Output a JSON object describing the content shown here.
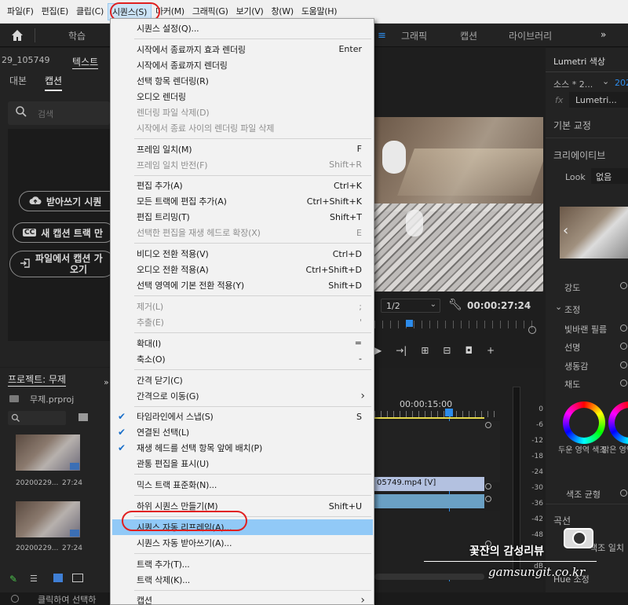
{
  "menubar": {
    "items": [
      "파일(F)",
      "편집(E)",
      "클립(C)",
      "시퀀스(S)",
      "마커(M)",
      "그래픽(G)",
      "보기(V)",
      "창(W)",
      "도움말(H)"
    ]
  },
  "workspace": {
    "tab_learn": "학습",
    "tab_graphics": "그래픽",
    "tab_captions": "캡션",
    "tab_libraries": "라이브러리",
    "more": "»"
  },
  "text_panel": {
    "sequence_name": "29_105749",
    "panel_title": "텍스트",
    "tab_transcript": "대본",
    "tab_captions": "캡션",
    "search_placeholder": "검색",
    "btn_transcribe": "받아쓰기 시퀀",
    "btn_new_caption_track": "새 캡션 트랙 만",
    "btn_import_captions_line1": "파일에서 캡션 가",
    "btn_import_captions_line2": "오기"
  },
  "program_monitor": {
    "resolution": "1/2",
    "timecode": "00:00:27:24"
  },
  "lumetri": {
    "title": "Lumetri 색상",
    "source_label": "소스 * 2...",
    "source_right": "202",
    "fx_label": "fx",
    "effect_name": "Lumetri...",
    "basic_correction": "기본 교정",
    "creative": "크리에이티브",
    "look_label": "Look",
    "look_value": "없음",
    "intensity": "강도",
    "adjust": "조정",
    "faded_film": "빛바랜 필름",
    "sharpen": "선명",
    "vibrance": "생동감",
    "saturation": "채도",
    "shadow_tint": "두운 영역 색조",
    "highlight_tint": "밝은 영역 색조",
    "tint_balance": "색조 균형",
    "curves": "곡선",
    "hue_match": "색조 일치",
    "hue_sat": "Hue 조정"
  },
  "project": {
    "title": "프로젝트: 무제",
    "file": "무제.prproj",
    "clips": [
      {
        "name": "20200229...",
        "duration": "27:24"
      },
      {
        "name": "20200229...",
        "duration": "27:24"
      }
    ]
  },
  "timeline": {
    "ruler_time": "00:00:15:00",
    "clip_label": "05749.mp4 [V]",
    "db_scale": [
      "0",
      "-6",
      "-12",
      "-18",
      "-24",
      "-30",
      "-36",
      "-42",
      "-48",
      "-54"
    ],
    "db_unit": "dB"
  },
  "status_bar": {
    "text": "클릭하여 선택하"
  },
  "sequence_menu": {
    "rows": [
      {
        "label": "시퀀스 설정(Q)...",
        "shortcut": "",
        "disabled": false
      },
      {
        "sep": true
      },
      {
        "label": "시작에서 종료까지 효과 렌더링",
        "shortcut": "Enter",
        "disabled": false
      },
      {
        "label": "시작에서 종료까지 렌더링",
        "shortcut": "",
        "disabled": false
      },
      {
        "label": "선택 항목 렌더링(R)",
        "shortcut": "",
        "disabled": false
      },
      {
        "label": "오디오 렌더링",
        "shortcut": "",
        "disabled": false
      },
      {
        "label": "렌더링 파일 삭제(D)",
        "shortcut": "",
        "disabled": true
      },
      {
        "label": "시작에서 종료 사이의 렌더링 파일 삭제",
        "shortcut": "",
        "disabled": true
      },
      {
        "sep": true
      },
      {
        "label": "프레임 일치(M)",
        "shortcut": "F",
        "disabled": false
      },
      {
        "label": "프레임 일치 반전(F)",
        "shortcut": "Shift+R",
        "disabled": true
      },
      {
        "sep": true
      },
      {
        "label": "편집 추가(A)",
        "shortcut": "Ctrl+K",
        "disabled": false
      },
      {
        "label": "모든 트랙에 편집 추가(A)",
        "shortcut": "Ctrl+Shift+K",
        "disabled": false
      },
      {
        "label": "편집 트리밍(T)",
        "shortcut": "Shift+T",
        "disabled": false
      },
      {
        "label": "선택한 편집을 재생 헤드로 확장(X)",
        "shortcut": "E",
        "disabled": true
      },
      {
        "sep": true
      },
      {
        "label": "비디오 전환 적용(V)",
        "shortcut": "Ctrl+D",
        "disabled": false
      },
      {
        "label": "오디오 전환 적용(A)",
        "shortcut": "Ctrl+Shift+D",
        "disabled": false
      },
      {
        "label": "선택 영역에 기본 전환 적용(Y)",
        "shortcut": "Shift+D",
        "disabled": false
      },
      {
        "sep": true
      },
      {
        "label": "제거(L)",
        "shortcut": ";",
        "disabled": true
      },
      {
        "label": "추출(E)",
        "shortcut": "'",
        "disabled": true
      },
      {
        "sep": true
      },
      {
        "label": "확대(I)",
        "shortcut": "=",
        "disabled": false
      },
      {
        "label": "축소(O)",
        "shortcut": "-",
        "disabled": false
      },
      {
        "sep": true
      },
      {
        "label": "간격 닫기(C)",
        "shortcut": "",
        "disabled": false
      },
      {
        "label": "간격으로 이동(G)",
        "shortcut": "",
        "disabled": false,
        "submenu": true
      },
      {
        "sep": true
      },
      {
        "label": "타임라인에서 스냅(S)",
        "shortcut": "S",
        "disabled": false,
        "checked": true
      },
      {
        "label": "연결된 선택(L)",
        "shortcut": "",
        "disabled": false,
        "checked": true
      },
      {
        "label": "재생 헤드를 선택 항목 앞에 배치(P)",
        "shortcut": "",
        "disabled": false,
        "checked": true
      },
      {
        "label": "관통 편집을 표시(U)",
        "shortcut": "",
        "disabled": false
      },
      {
        "sep": true
      },
      {
        "label": "믹스 트랙 표준화(N)...",
        "shortcut": "",
        "disabled": false
      },
      {
        "sep": true
      },
      {
        "label": "하위 시퀀스 만들기(M)",
        "shortcut": "Shift+U",
        "disabled": false
      },
      {
        "sep": true
      },
      {
        "label": "시퀀스 자동 리프레임(A)...",
        "shortcut": "",
        "disabled": false,
        "highlighted": true
      },
      {
        "label": "시퀀스 자동 받아쓰기(A)...",
        "shortcut": "",
        "disabled": false
      },
      {
        "sep": true
      },
      {
        "label": "트랙 추가(T)...",
        "shortcut": "",
        "disabled": false
      },
      {
        "label": "트랙 삭제(K)...",
        "shortcut": "",
        "disabled": false
      },
      {
        "sep": true
      },
      {
        "label": "캡션",
        "shortcut": "",
        "disabled": false,
        "submenu": true
      }
    ]
  },
  "watermark": {
    "title": "꽃잔의 감성리뷰",
    "url": "gamsungit.co.kr"
  },
  "colors": {
    "accent_blue": "#2d8ceb",
    "highlight_row": "#91c9f7",
    "annotation_red": "#e02020",
    "panel_bg": "#232323"
  }
}
